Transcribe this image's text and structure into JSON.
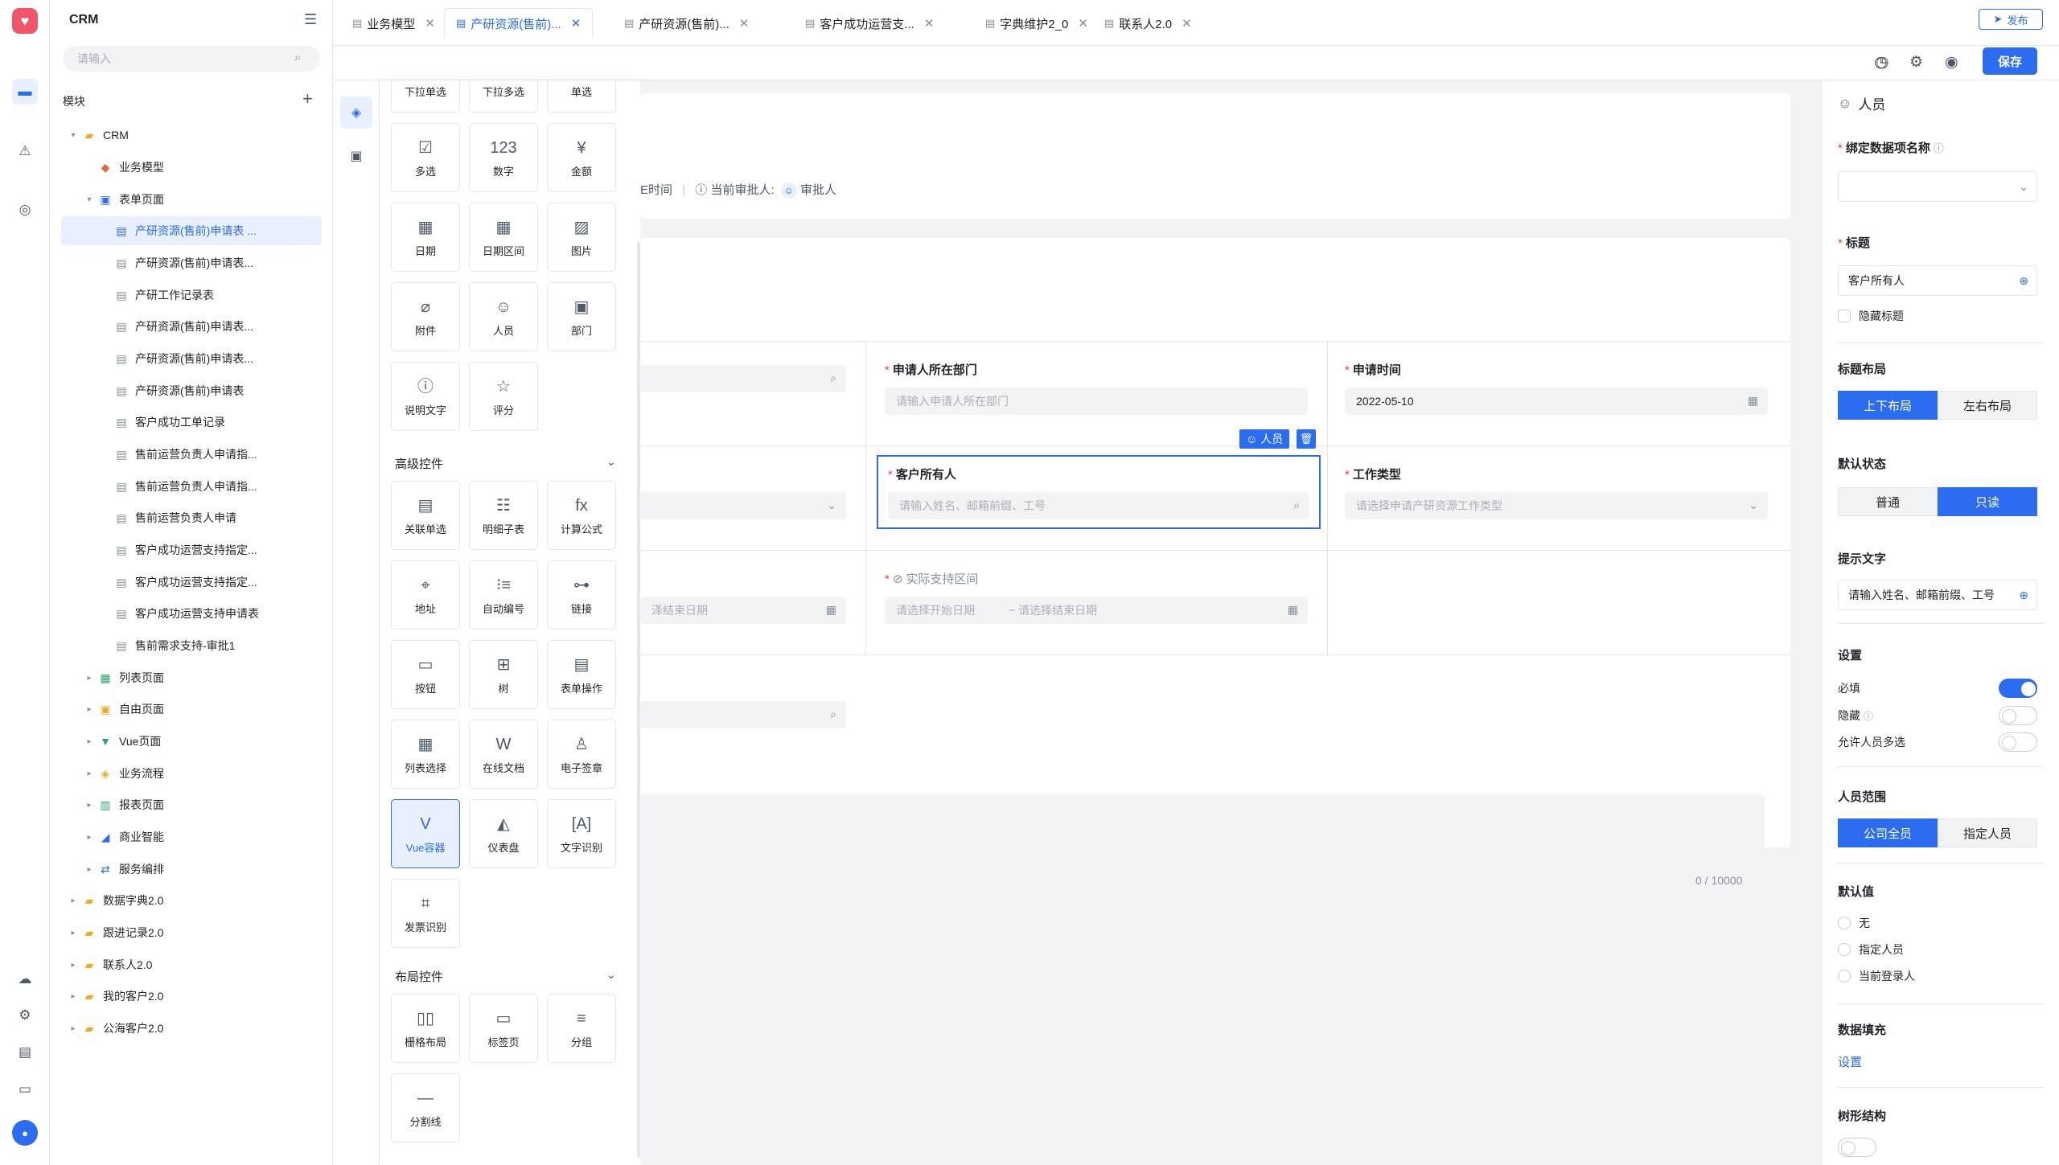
{
  "app": {
    "name": "CRM"
  },
  "tree": {
    "search_placeholder": "请输入",
    "section_label": "模块",
    "items": [
      {
        "label": "CRM"
      },
      {
        "label": "业务模型"
      },
      {
        "label": "表单页面"
      },
      {
        "label": "产研资源(售前)申请表 ..."
      },
      {
        "label": "产研资源(售前)申请表..."
      },
      {
        "label": "产研工作记录表"
      },
      {
        "label": "产研资源(售前)申请表..."
      },
      {
        "label": "产研资源(售前)申请表..."
      },
      {
        "label": "产研资源(售前)申请表"
      },
      {
        "label": "客户成功工单记录"
      },
      {
        "label": "售前运营负责人申请指..."
      },
      {
        "label": "售前运营负责人申请指..."
      },
      {
        "label": "售前运营负责人申请"
      },
      {
        "label": "客户成功运营支持指定..."
      },
      {
        "label": "客户成功运营支持指定..."
      },
      {
        "label": "客户成功运营支持申请表"
      },
      {
        "label": "售前需求支持-审批1"
      },
      {
        "label": "列表页面"
      },
      {
        "label": "自由页面"
      },
      {
        "label": "Vue页面"
      },
      {
        "label": "业务流程"
      },
      {
        "label": "报表页面"
      },
      {
        "label": "商业智能"
      },
      {
        "label": "服务编排"
      },
      {
        "label": "数据字典2.0"
      },
      {
        "label": "跟进记录2.0"
      },
      {
        "label": "联系人2.0"
      },
      {
        "label": "我的客户2.0"
      },
      {
        "label": "公海客户2.0"
      }
    ]
  },
  "tabs": [
    {
      "label": "业务模型"
    },
    {
      "label": "产研资源(售前)..."
    },
    {
      "label": "产研资源(售前)..."
    },
    {
      "label": "客户成功运营支..."
    },
    {
      "label": "字典维护2_0"
    },
    {
      "label": "联系人2.0"
    }
  ],
  "toolbar": {
    "publish_label": "发布",
    "save_label": "保存"
  },
  "palette": {
    "basic": [
      "下拉单选",
      "下拉多选",
      "单选",
      "多选",
      "数字",
      "金额",
      "日期",
      "日期区间",
      "图片",
      "附件",
      "人员",
      "部门",
      "说明文字",
      "评分"
    ],
    "number_glyph": "123",
    "advanced_title": "高级控件",
    "advanced": [
      "关联单选",
      "明细子表",
      "计算公式",
      "地址",
      "自动编号",
      "链接",
      "按钮",
      "树",
      "表单操作",
      "列表选择",
      "在线文档",
      "电子签章",
      "Vue容器",
      "仪表盘",
      "文字识别",
      "发票识别"
    ],
    "layout_title": "布局控件",
    "layout": [
      "栅格布局",
      "标签页",
      "分组",
      "分割线"
    ]
  },
  "canvas": {
    "header": {
      "time_suffix": "E时间",
      "approver_label": "当前审批人:",
      "approver_value": "审批人"
    },
    "fields": {
      "dept_label": "申请人所在部门",
      "dept_placeholder": "请输入申请人所在部门",
      "time_label": "申请时间",
      "time_value": "2022-05-10",
      "owner_label": "客户所有人",
      "owner_placeholder": "请输入姓名、邮箱前缀、工号",
      "work_type_label": "工作类型",
      "work_type_placeholder": "请选择申请产研资源工作类型",
      "actual_range_label": "实际支持区间",
      "range_start_placeholder": "请选择开始日期",
      "range_end_placeholder": "~ 请选择结束日期",
      "left_range_end": "泽结束日期"
    },
    "selected_tag": "人员",
    "textarea_counter": "0 / 10000"
  },
  "props": {
    "header": "人员",
    "bind_label": "绑定数据项名称",
    "title_label": "标题",
    "title_value": "客户所有人",
    "hide_title": "隐藏标题",
    "title_layout_label": "标题布局",
    "title_layout_options": [
      "上下布局",
      "左右布局"
    ],
    "default_state_label": "默认状态",
    "default_state_options": [
      "普通",
      "只读"
    ],
    "hint_label": "提示文字",
    "hint_value": "请输入姓名、邮箱前缀、工号",
    "settings_label": "设置",
    "settings": [
      {
        "label": "必填",
        "on": true
      },
      {
        "label": "隐藏",
        "on": false
      },
      {
        "label": "允许人员多选",
        "on": false
      }
    ],
    "scope_label": "人员范围",
    "scope_options": [
      "公司全员",
      "指定人员"
    ],
    "default_value_label": "默认值",
    "default_value_options": [
      "无",
      "指定人员",
      "当前登录人"
    ],
    "data_fill_label": "数据填充",
    "data_fill_link": "设置",
    "tree_label": "树形结构"
  },
  "colors": {
    "accent": "#2b6cf0",
    "danger": "#f53f3f",
    "logo": "#f1556a"
  }
}
